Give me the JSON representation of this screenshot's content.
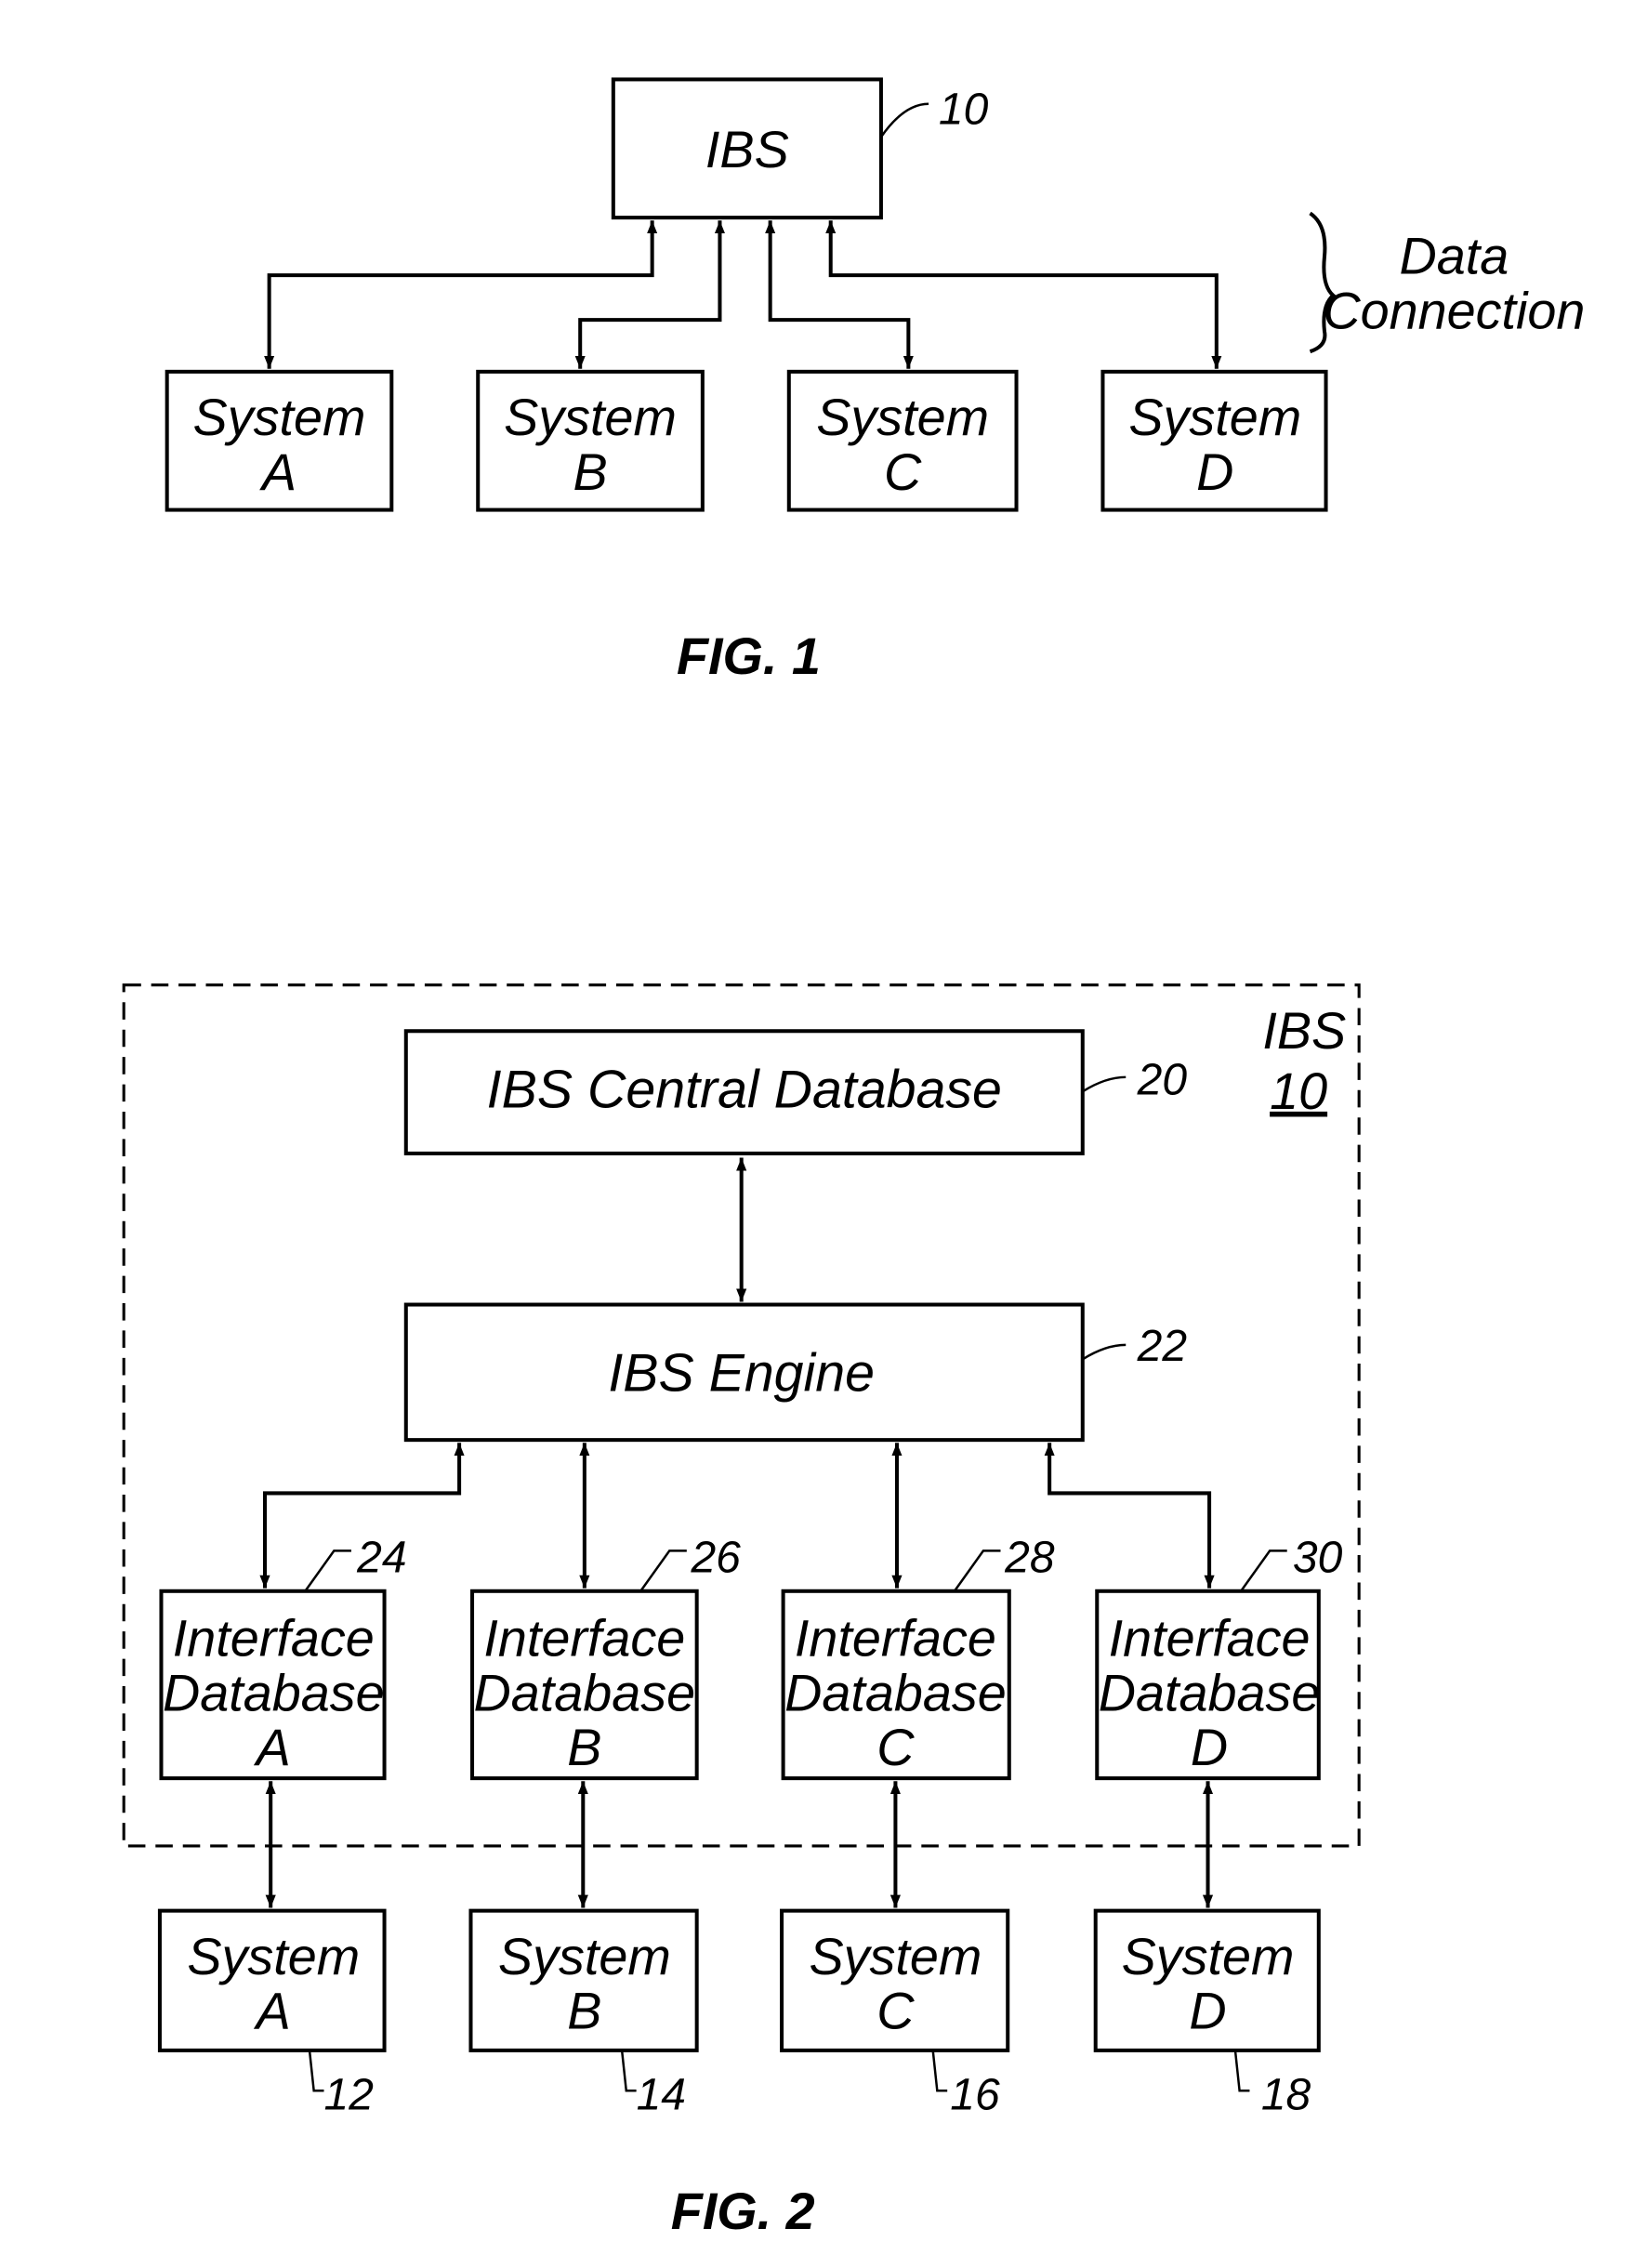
{
  "fig1": {
    "caption": "FIG. 1",
    "ibs": {
      "label": "IBS",
      "ref": "10"
    },
    "connection_label": {
      "line1": "Data",
      "line2": "Connection"
    },
    "systems": [
      {
        "line1": "System",
        "line2": "A"
      },
      {
        "line1": "System",
        "line2": "B"
      },
      {
        "line1": "System",
        "line2": "C"
      },
      {
        "line1": "System",
        "line2": "D"
      }
    ]
  },
  "fig2": {
    "caption": "FIG. 2",
    "boundary": {
      "label": "IBS",
      "ref": "10"
    },
    "central_db": {
      "label": "IBS Central Database",
      "ref": "20"
    },
    "engine": {
      "label": "IBS Engine",
      "ref": "22"
    },
    "interface_dbs": [
      {
        "line1": "Interface",
        "line2": "Database",
        "line3": "A",
        "ref": "24"
      },
      {
        "line1": "Interface",
        "line2": "Database",
        "line3": "B",
        "ref": "26"
      },
      {
        "line1": "Interface",
        "line2": "Database",
        "line3": "C",
        "ref": "28"
      },
      {
        "line1": "Interface",
        "line2": "Database",
        "line3": "D",
        "ref": "30"
      }
    ],
    "systems": [
      {
        "line1": "System",
        "line2": "A",
        "ref": "12"
      },
      {
        "line1": "System",
        "line2": "B",
        "ref": "14"
      },
      {
        "line1": "System",
        "line2": "C",
        "ref": "16"
      },
      {
        "line1": "System",
        "line2": "D",
        "ref": "18"
      }
    ]
  }
}
